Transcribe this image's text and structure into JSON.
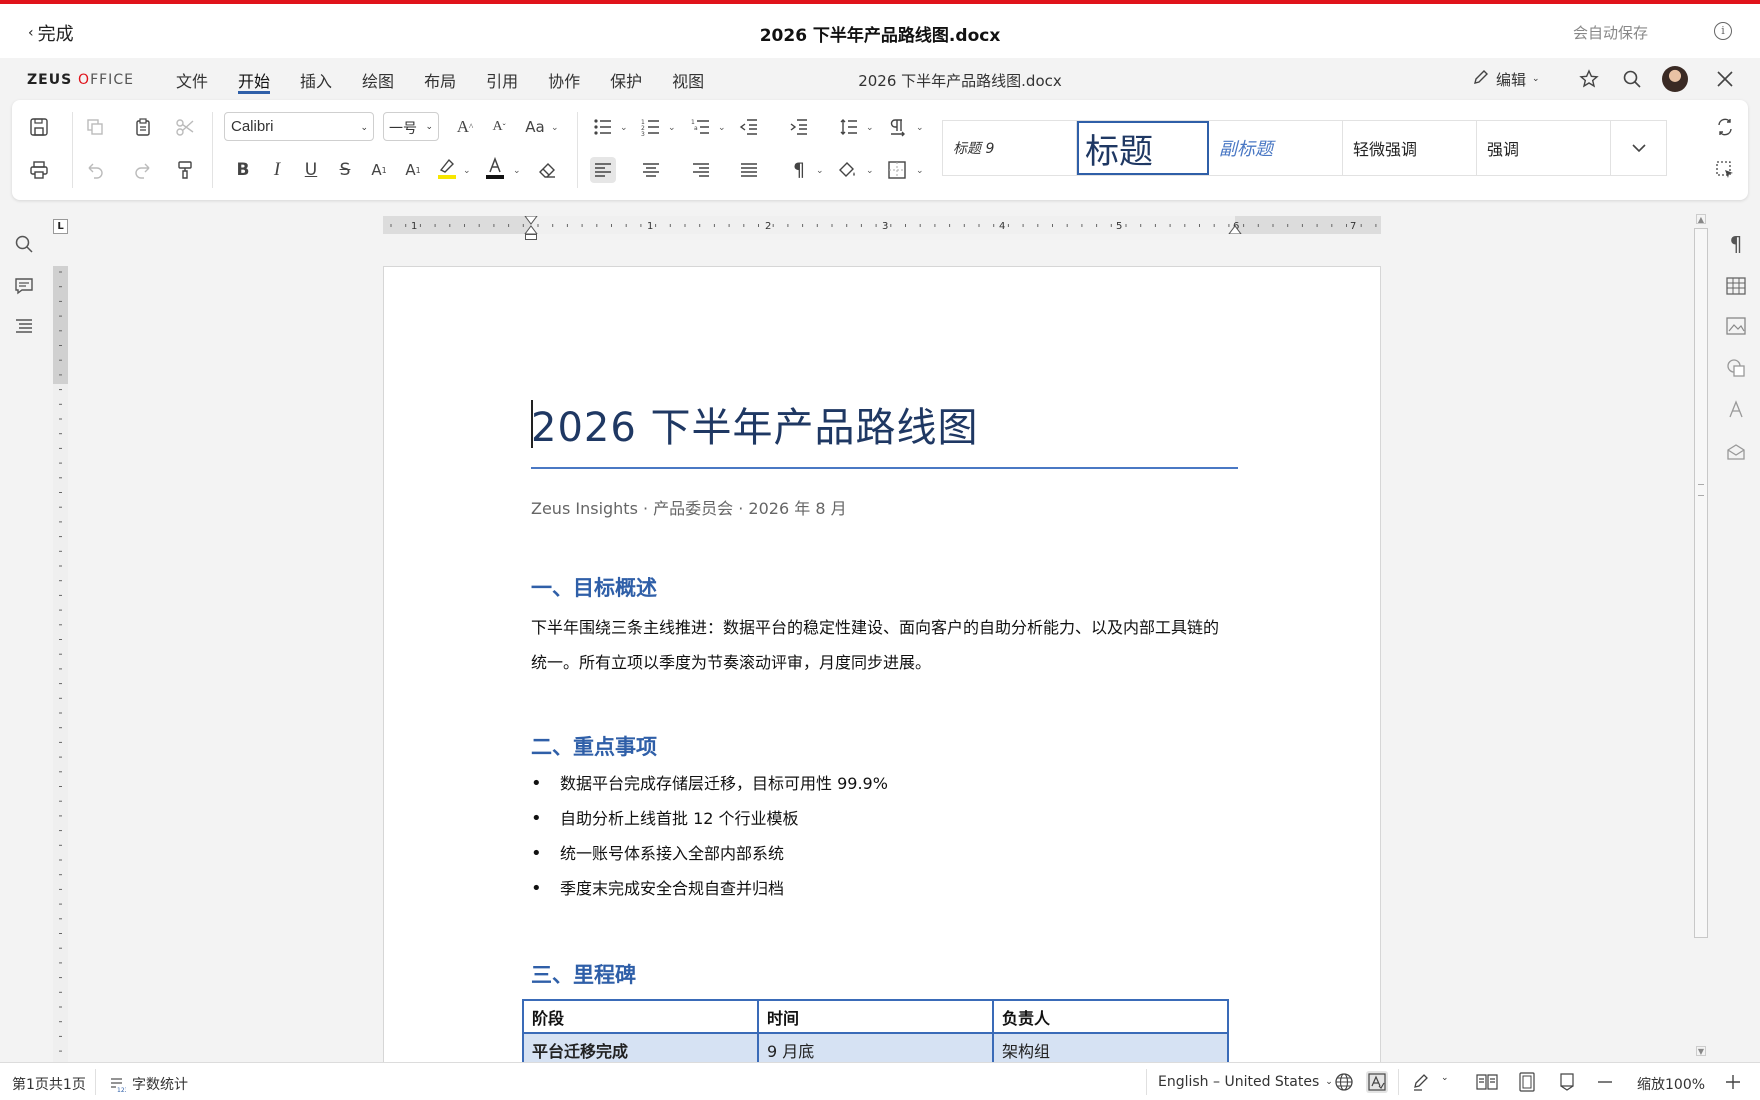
{
  "titlebar": {
    "back_label": "完成",
    "doc_title": "2026 下半年产品路线图.docx",
    "autosave": "会自动保存"
  },
  "brand": {
    "logo_bold": "ZEUS",
    "logo_o": "O",
    "logo_rest": "FFICE",
    "accent": "#e0131b"
  },
  "menubar": {
    "items": [
      "文件",
      "开始",
      "插入",
      "绘图",
      "布局",
      "引用",
      "协作",
      "保护",
      "视图"
    ],
    "active_index": 1,
    "center_title": "2026 下半年产品路线图.docx",
    "edit_label": "编辑"
  },
  "ribbon": {
    "font_name": "Calibri",
    "font_size": "一号",
    "styles": [
      {
        "label": "标题 9",
        "style": "heading9"
      },
      {
        "label": "标题",
        "style": "title",
        "selected": true
      },
      {
        "label": "副标题",
        "style": "subtitle"
      },
      {
        "label": "轻微强调",
        "style": "subtle"
      },
      {
        "label": "强调",
        "style": "emphasis"
      }
    ]
  },
  "ruler": {
    "labels": [
      "1",
      "1",
      "2",
      "3",
      "4",
      "5",
      "6",
      "7"
    ]
  },
  "document": {
    "title": "2026 下半年产品路线图",
    "subtitle": "Zeus Insights · 产品委员会 · 2026 年 8 月",
    "section1": {
      "heading": "一、目标概述",
      "body": "下半年围绕三条主线推进：数据平台的稳定性建设、面向客户的自助分析能力、以及内部工具链的统一。所有立项以季度为节奏滚动评审，月度同步进展。"
    },
    "section2": {
      "heading": "二、重点事项",
      "bullets": [
        "数据平台完成存储层迁移，目标可用性 99.9%",
        "自助分析上线首批 12 个行业模板",
        "统一账号体系接入全部内部系统",
        "季度末完成安全合规自查并归档"
      ]
    },
    "section3": {
      "heading": "三、里程碑",
      "table": {
        "headers": [
          "阶段",
          "时间",
          "负责人"
        ],
        "rows": [
          [
            "平台迁移完成",
            "9 月底",
            "架构组"
          ]
        ]
      }
    }
  },
  "statusbar": {
    "page_info": "第1页共1页",
    "word_count": "字数统计",
    "language": "English – United States",
    "zoom": "缩放100%"
  }
}
